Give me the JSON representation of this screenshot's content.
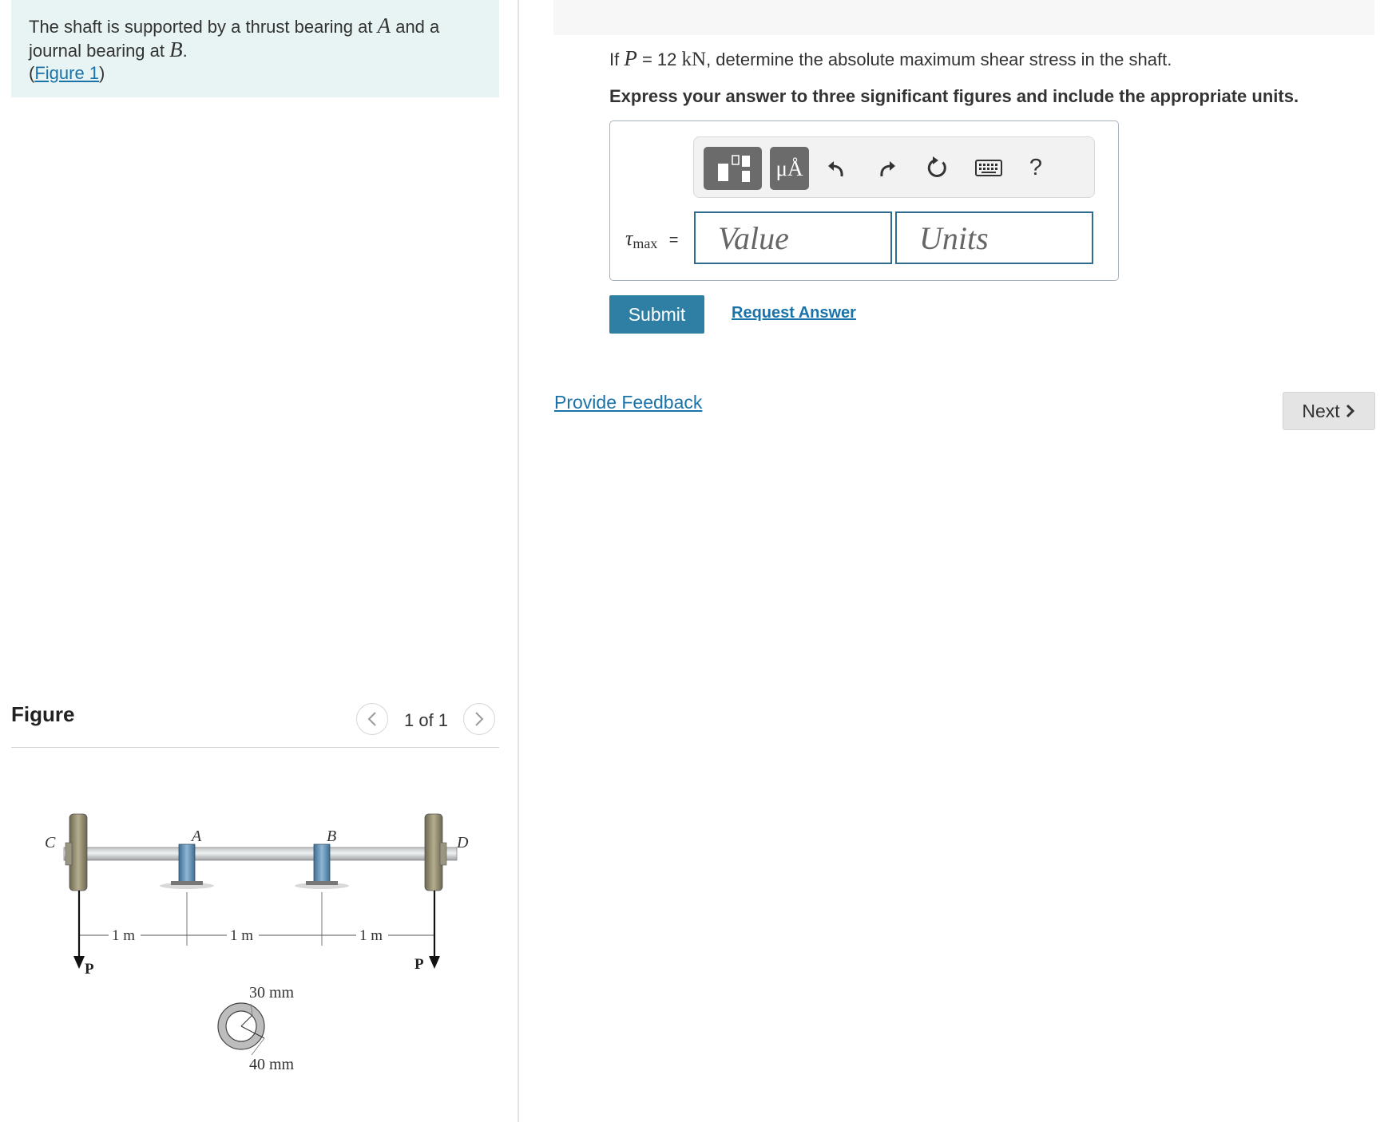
{
  "intro": {
    "line1_pre": "The shaft is supported by a thrust bearing at ",
    "var_a": "A",
    "line1_post": " and a",
    "line2_pre": "journal bearing at ",
    "var_b": "B",
    "line2_post": ".",
    "figure_link": "Figure 1",
    "paren_open": "(",
    "paren_close": ")"
  },
  "figure": {
    "heading": "Figure",
    "pager": {
      "count": "1 of 1",
      "prev_icon": "chevron-left-icon",
      "next_icon": "chevron-right-icon"
    },
    "labels": {
      "c": "C",
      "a": "A",
      "b": "B",
      "d": "D",
      "p_left": "P",
      "p_right": "P",
      "dim1": "1 m",
      "dim2": "1 m",
      "dim3": "1 m",
      "inner": "30 mm",
      "outer": "40 mm"
    }
  },
  "question": {
    "if": "If ",
    "var_p": "P",
    "eq": " = 12 ",
    "unit": "kN",
    "rest": ", determine the absolute maximum shear stress in the shaft.",
    "instruction": "Express your answer to three significant figures and include the appropriate units."
  },
  "answer": {
    "tau": "τ",
    "tau_sub": "max",
    "equals": "=",
    "value_placeholder": "Value",
    "units_placeholder": "Units",
    "toolbar": {
      "templates_icon": "templates-icon",
      "units_label": "μÅ",
      "undo_icon": "undo-icon",
      "redo_icon": "redo-icon",
      "reset_icon": "reset-icon",
      "keyboard_icon": "keyboard-icon",
      "help_label": "?"
    }
  },
  "actions": {
    "submit": "Submit",
    "request_answer": "Request Answer",
    "provide_feedback": "Provide Feedback",
    "next": "Next"
  },
  "colors": {
    "intro_bg": "#e8f4f4",
    "link": "#1a73a8",
    "submit_bg": "#2f7ea3",
    "input_border": "#2f6d8f",
    "toolbar_dark": "#6b6b6b"
  }
}
